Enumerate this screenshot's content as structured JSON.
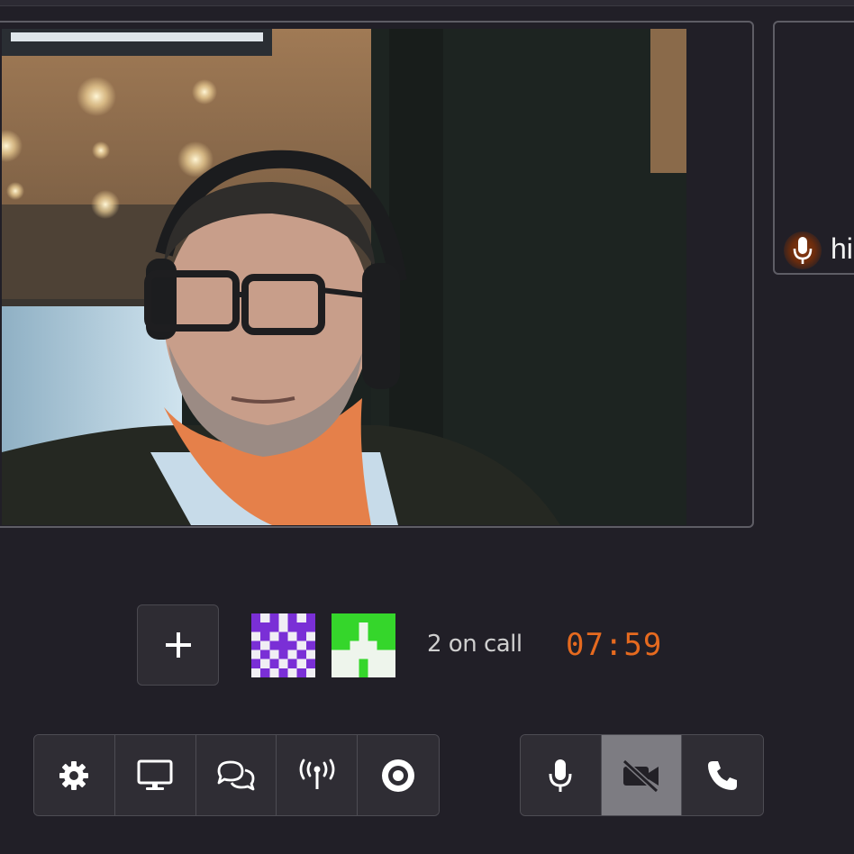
{
  "side_tile": {
    "name_partial": "hi"
  },
  "participants": {
    "count_label": "2 on call",
    "timer": "07:59"
  },
  "toolbar_left": [
    "settings-icon",
    "screen-share-icon",
    "chat-icon",
    "broadcast-icon",
    "record-icon"
  ],
  "toolbar_right": [
    "microphone-icon",
    "camera-off-icon",
    "phone-icon"
  ],
  "colors": {
    "background": "#211f27",
    "accent": "#e66a1f",
    "active_button": "#7d7c82",
    "avatar1": "#7a2fd6",
    "avatar2": "#35d62b"
  }
}
